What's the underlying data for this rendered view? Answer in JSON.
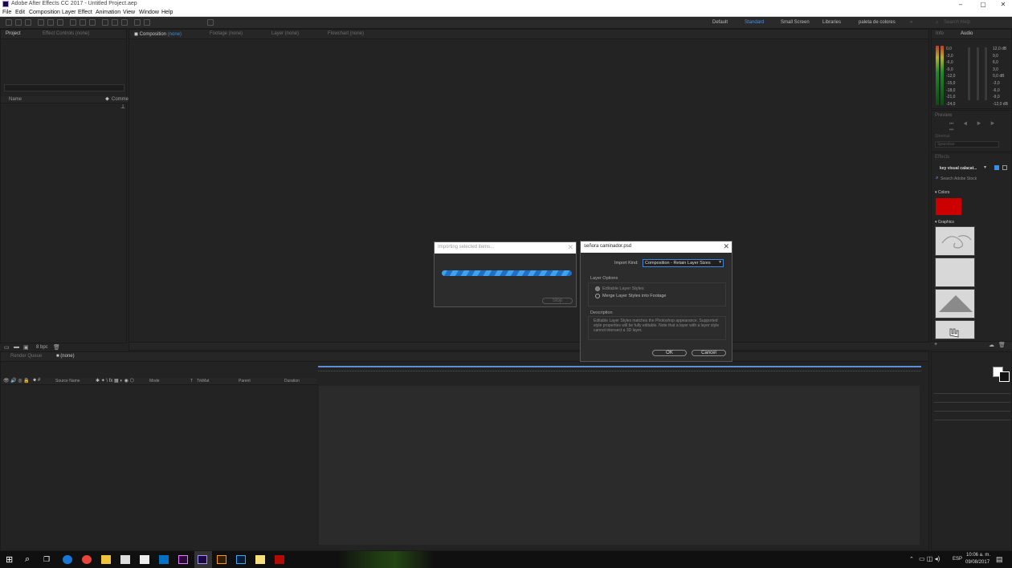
{
  "window": {
    "title": "Adobe After Effects CC 2017 - Untitled Project.aep"
  },
  "menu": [
    "File",
    "Edit",
    "Composition",
    "Layer",
    "Effect",
    "Animation",
    "View",
    "Window",
    "Help"
  ],
  "workspaces": [
    "Default",
    "Standard",
    "Small Screen",
    "Libraries",
    "paleta de colores"
  ],
  "search_help_placeholder": "Search Help",
  "project_panel": {
    "tab_project": "Project",
    "tab_effect_controls": "Effect Controls (none)",
    "col_name": "Name",
    "col_comment": "Commen",
    "bpc": "8 bpc"
  },
  "comp_panel": {
    "tab_composition": "Composition",
    "tab_composition_value": "(none)",
    "tab_footage": "Footage (none)",
    "tab_layer": "Layer (none)",
    "tab_flowchart": "Flowchart (none)"
  },
  "right_panel": {
    "tab_info": "Info",
    "tab_audio": "Audio",
    "preview_title": "Preview",
    "shortcut_label": "Shortcut",
    "shortcut_value": "Spacebar",
    "tab_effects": "Effects",
    "library_name": "key visual calacat...",
    "search_stock": "Search Adobe Stock",
    "colors_label": "Colors",
    "graphics_label": "Graphics",
    "color_red": "#cc0000",
    "audio_db_left": [
      "0,0",
      "-3,0",
      "-6,0",
      "-9,0",
      "-12,0",
      "-15,0",
      "-18,0",
      "-21,0",
      "-24,0"
    ],
    "audio_db_right": [
      "12,0 dB",
      "9,0",
      "6,0",
      "3,0",
      "0,0 dB",
      "-3,0",
      "-6,0",
      "-9,0",
      "-12,0 dB"
    ]
  },
  "timeline": {
    "tab_render_queue": "Render Queue",
    "tab_none": "(none)",
    "col_source_name": "Source Name",
    "col_mode": "Mode",
    "col_t": "T",
    "col_trkmat": "TrkMat",
    "col_parent": "Parent",
    "col_duration": "Duration"
  },
  "importing_dialog": {
    "title": "Importing selected items...",
    "stop_label": "Stop"
  },
  "import_dialog": {
    "title": "señora caminador.psd",
    "import_kind_label": "Import Kind:",
    "import_kind_value": "Composition - Retain Layer Sizes",
    "layer_options_label": "Layer Options",
    "option_editable": "Editable Layer Styles",
    "option_merge": "Merge Layer Styles into Footage",
    "description_label": "Description",
    "description_text": "Editable Layer Styles matches the Photoshop appearance. Supported style properties will be fully editable. Note that a layer with a layer style cannot intersect a 3D layer.",
    "ok_label": "OK",
    "cancel_label": "Cancel"
  },
  "taskbar": {
    "lang": "ESP",
    "time": "10:06 a. m.",
    "date": "09/08/2017"
  }
}
